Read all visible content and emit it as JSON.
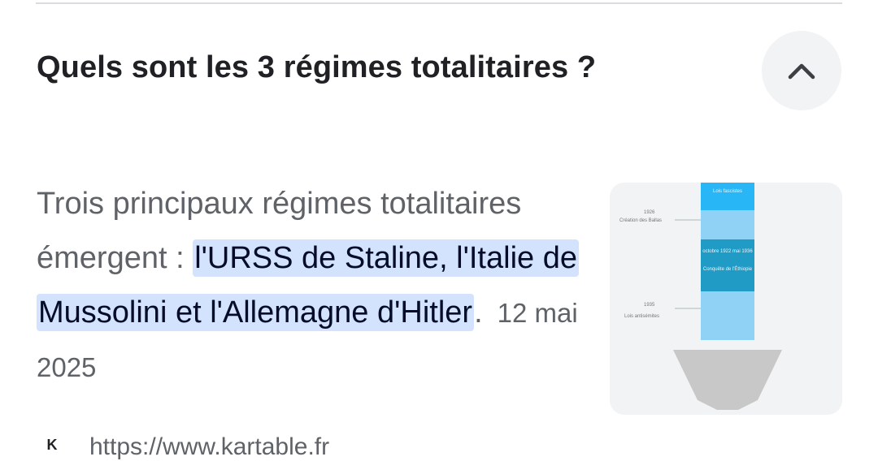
{
  "faq": {
    "question": "Quels sont les 3 régimes totalitaires ?",
    "answer_plain": "Trois principaux régimes totalitaires émergent : ",
    "answer_highlight": "l'URSS de Staline, l'Italie de Mussolini et l'Allemagne d'Hitler",
    "answer_end": ".",
    "date": "12 mai 2025"
  },
  "thumbnail": {
    "label_1926": "1926",
    "label_creation": "Création des Ballas",
    "label_lois": "Lois fascistes",
    "label_oct": "octobre 1922 mai 1936",
    "label_conquete": "Conquête de l'Éthiopie",
    "label_1935": "1935",
    "label_antisemites": "Lois antisémites"
  },
  "source": {
    "favicon_letter": "K",
    "url": "https://www.kartable.fr"
  },
  "icons": {
    "collapse": "chevron-up-icon"
  }
}
